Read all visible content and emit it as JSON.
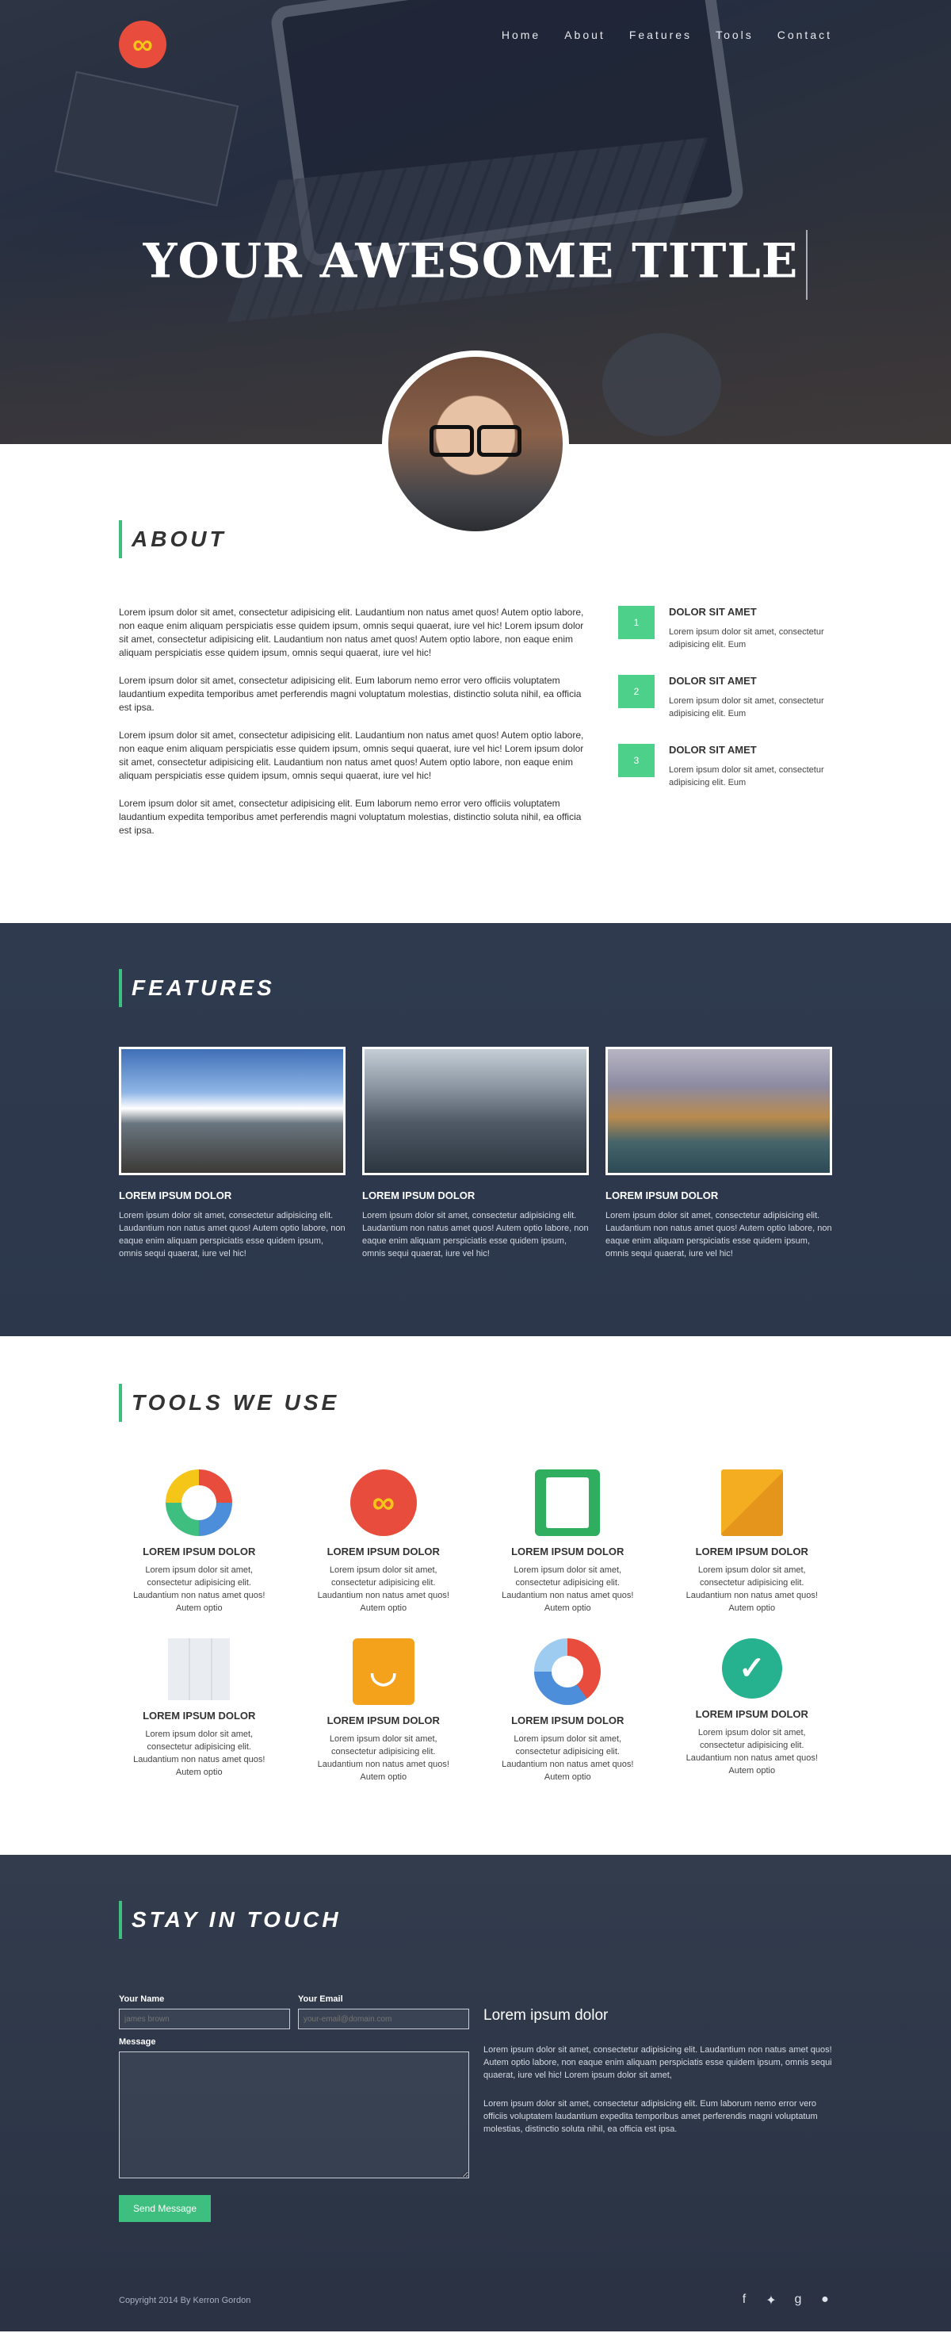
{
  "nav": {
    "logo_glyph": "∞",
    "items": [
      "Home",
      "About",
      "Features",
      "Tools",
      "Contact"
    ]
  },
  "hero": {
    "title": "YOUR AWESOME TITLE"
  },
  "about": {
    "heading": "ABOUT",
    "paragraphs": [
      "Lorem ipsum dolor sit amet, consectetur adipisicing elit. Laudantium non natus amet quos! Autem optio labore, non eaque enim aliquam perspiciatis esse quidem ipsum, omnis sequi quaerat, iure vel hic! Lorem ipsum dolor sit amet, consectetur adipisicing elit. Laudantium non natus amet quos! Autem optio labore, non eaque enim aliquam perspiciatis esse quidem ipsum, omnis sequi quaerat, iure vel hic!",
      "Lorem ipsum dolor sit amet, consectetur adipisicing elit. Eum laborum nemo error vero officiis voluptatem laudantium expedita temporibus amet perferendis magni voluptatum molestias, distinctio soluta nihil, ea officia est ipsa.",
      "Lorem ipsum dolor sit amet, consectetur adipisicing elit. Laudantium non natus amet quos! Autem optio labore, non eaque enim aliquam perspiciatis esse quidem ipsum, omnis sequi quaerat, iure vel hic! Lorem ipsum dolor sit amet, consectetur adipisicing elit. Laudantium non natus amet quos! Autem optio labore, non eaque enim aliquam perspiciatis esse quidem ipsum, omnis sequi quaerat, iure vel hic!",
      "Lorem ipsum dolor sit amet, consectetur adipisicing elit. Eum laborum nemo error vero officiis voluptatem laudantium expedita temporibus amet perferendis magni voluptatum molestias, distinctio soluta nihil, ea officia est ipsa."
    ],
    "steps": [
      {
        "num": "1",
        "title": "DOLOR SIT AMET",
        "text": "Lorem ipsum dolor sit amet, consectetur adipisicing elit. Eum"
      },
      {
        "num": "2",
        "title": "DOLOR SIT AMET",
        "text": "Lorem ipsum dolor sit amet, consectetur adipisicing elit. Eum"
      },
      {
        "num": "3",
        "title": "DOLOR SIT AMET",
        "text": "Lorem ipsum dolor sit amet, consectetur adipisicing elit. Eum"
      }
    ]
  },
  "features": {
    "heading": "FEATURES",
    "items": [
      {
        "title": "LOREM IPSUM DOLOR",
        "text": "Lorem ipsum dolor sit amet, consectetur adipisicing elit. Laudantium non natus amet quos! Autem optio labore, non eaque enim aliquam perspiciatis esse quidem ipsum, omnis sequi quaerat, iure vel hic!"
      },
      {
        "title": "LOREM IPSUM DOLOR",
        "text": "Lorem ipsum dolor sit amet, consectetur adipisicing elit. Laudantium non natus amet quos! Autem optio labore, non eaque enim aliquam perspiciatis esse quidem ipsum, omnis sequi quaerat, iure vel hic!"
      },
      {
        "title": "LOREM IPSUM DOLOR",
        "text": "Lorem ipsum dolor sit amet, consectetur adipisicing elit. Laudantium non natus amet quos! Autem optio labore, non eaque enim aliquam perspiciatis esse quidem ipsum, omnis sequi quaerat, iure vel hic!"
      }
    ]
  },
  "tools": {
    "heading": "TOOLS WE USE",
    "items": [
      {
        "icon": "compass-icon",
        "title": "LOREM IPSUM DOLOR",
        "text": "Lorem ipsum dolor sit amet, consectetur adipisicing elit. Laudantium non natus amet quos! Autem optio"
      },
      {
        "icon": "infinity-icon",
        "title": "LOREM IPSUM DOLOR",
        "text": "Lorem ipsum dolor sit amet, consectetur adipisicing elit. Laudantium non natus amet quos! Autem optio"
      },
      {
        "icon": "clipboard-icon",
        "title": "LOREM IPSUM DOLOR",
        "text": "Lorem ipsum dolor sit amet, consectetur adipisicing elit. Laudantium non natus amet quos! Autem optio"
      },
      {
        "icon": "mail-icon",
        "title": "LOREM IPSUM DOLOR",
        "text": "Lorem ipsum dolor sit amet, consectetur adipisicing elit. Laudantium non natus amet quos! Autem optio"
      },
      {
        "icon": "map-icon",
        "title": "LOREM IPSUM DOLOR",
        "text": "Lorem ipsum dolor sit amet, consectetur adipisicing elit. Laudantium non natus amet quos! Autem optio"
      },
      {
        "icon": "shopping-bag-icon",
        "title": "LOREM IPSUM DOLOR",
        "text": "Lorem ipsum dolor sit amet, consectetur adipisicing elit. Laudantium non natus amet quos! Autem optio"
      },
      {
        "icon": "ring-chart-icon",
        "title": "LOREM IPSUM DOLOR",
        "text": "Lorem ipsum dolor sit amet, consectetur adipisicing elit. Laudantium non natus amet quos! Autem optio"
      },
      {
        "icon": "checkmark-icon",
        "title": "LOREM IPSUM DOLOR",
        "text": "Lorem ipsum dolor sit amet, consectetur adipisicing elit. Laudantium non natus amet quos! Autem optio"
      }
    ]
  },
  "contact": {
    "heading": "STAY IN TOUCH",
    "name_label": "Your Name",
    "name_placeholder": "james brown",
    "email_label": "Your Email",
    "email_placeholder": "your-email@domain.com",
    "message_label": "Message",
    "send_label": "Send Message",
    "info_title": "Lorem ipsum dolor",
    "info_paragraphs": [
      "Lorem ipsum dolor sit amet, consectetur adipisicing elit. Laudantium non natus amet quos! Autem optio labore, non eaque enim aliquam perspiciatis esse quidem ipsum, omnis sequi quaerat, iure vel hic! Lorem ipsum dolor sit amet,",
      "Lorem ipsum dolor sit amet, consectetur adipisicing elit. Eum laborum nemo error vero officiis voluptatem laudantium expedita temporibus amet perferendis magni voluptatum molestias, distinctio soluta nihil, ea officia est ipsa."
    ]
  },
  "footer": {
    "copyright": "Copyright 2014 By Kerron Gordon",
    "social": [
      "facebook-icon",
      "twitter-icon",
      "google-plus-icon",
      "github-icon"
    ]
  },
  "colors": {
    "accent": "#3fbf7f",
    "brand": "#e84c3d",
    "dark_section": "#2f3a4e"
  }
}
